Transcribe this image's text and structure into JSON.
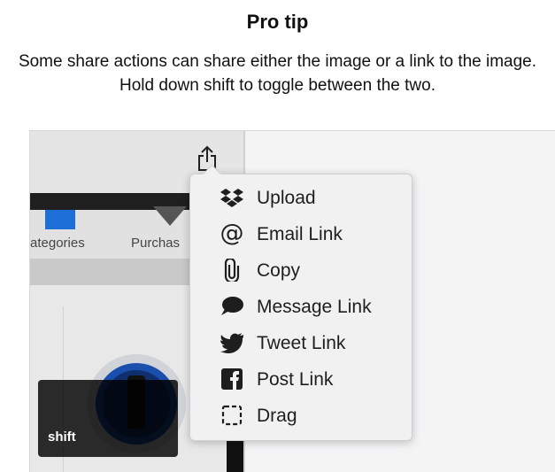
{
  "tip": {
    "title": "Pro tip",
    "description": "Some share actions can share either the image or a link to the image. Hold down shift to toggle between the two."
  },
  "app": {
    "tabs": [
      {
        "label": "ategories",
        "icon": "folder-icon"
      },
      {
        "label": "Purchas",
        "icon": "heart-icon"
      }
    ]
  },
  "share_menu": {
    "items": [
      {
        "label": "Upload",
        "icon": "dropbox-icon"
      },
      {
        "label": "Email Link",
        "icon": "at-icon"
      },
      {
        "label": "Copy",
        "icon": "paperclip-icon"
      },
      {
        "label": "Message Link",
        "icon": "speech-bubble-icon"
      },
      {
        "label": "Tweet Link",
        "icon": "twitter-bird-icon"
      },
      {
        "label": "Post Link",
        "icon": "facebook-icon"
      },
      {
        "label": "Drag",
        "icon": "dashed-square-icon"
      }
    ]
  },
  "keyboard": {
    "shift_label": "shift"
  },
  "colors": {
    "accent_blue": "#1f6fd9",
    "menu_bg": "#f1f1f1",
    "key_overlay": "#000000"
  }
}
